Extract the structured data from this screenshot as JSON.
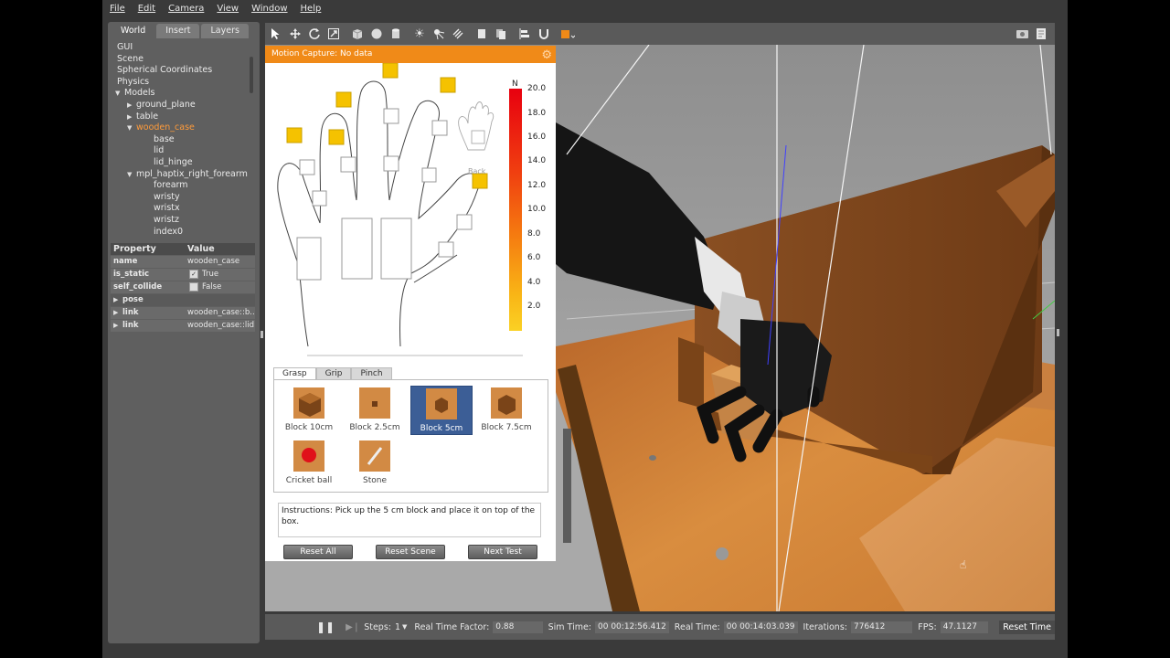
{
  "menu": [
    "File",
    "Edit",
    "Camera",
    "View",
    "Window",
    "Help"
  ],
  "left_tabs": [
    "World",
    "Insert",
    "Layers"
  ],
  "tree": [
    {
      "label": "GUI",
      "indent": 0,
      "arrow": ""
    },
    {
      "label": "Scene",
      "indent": 0,
      "arrow": ""
    },
    {
      "label": "Spherical Coordinates",
      "indent": 0,
      "arrow": ""
    },
    {
      "label": "Physics",
      "indent": 0,
      "arrow": ""
    },
    {
      "label": "Models",
      "indent": 0,
      "arrow": "down"
    },
    {
      "label": "ground_plane",
      "indent": 1,
      "arrow": "right"
    },
    {
      "label": "table",
      "indent": 1,
      "arrow": "right"
    },
    {
      "label": "wooden_case",
      "indent": 1,
      "arrow": "down",
      "selected": true
    },
    {
      "label": "base",
      "indent": 2,
      "arrow": ""
    },
    {
      "label": "lid",
      "indent": 2,
      "arrow": ""
    },
    {
      "label": "lid_hinge",
      "indent": 2,
      "arrow": ""
    },
    {
      "label": "mpl_haptix_right_forearm",
      "indent": 1,
      "arrow": "down"
    },
    {
      "label": "forearm",
      "indent": 2,
      "arrow": ""
    },
    {
      "label": "wristy",
      "indent": 2,
      "arrow": ""
    },
    {
      "label": "wristx",
      "indent": 2,
      "arrow": ""
    },
    {
      "label": "wristz",
      "indent": 2,
      "arrow": ""
    },
    {
      "label": "index0",
      "indent": 2,
      "arrow": ""
    }
  ],
  "props": {
    "header": [
      "Property",
      "Value"
    ],
    "name": {
      "label": "name",
      "value": "wooden_case"
    },
    "is_static": {
      "label": "is_static",
      "value": "True",
      "checked": true
    },
    "self_collide": {
      "label": "self_collide",
      "value": "False",
      "checked": false
    },
    "pose": "pose",
    "link1": {
      "label": "link",
      "value": "wooden_case::b..."
    },
    "link2": {
      "label": "link",
      "value": "wooden_case::lid"
    }
  },
  "mocap": {
    "title": "Motion Capture: No data",
    "back_label": "Back",
    "legend_unit": "N",
    "legend_ticks": [
      "20.0",
      "18.0",
      "16.0",
      "14.0",
      "12.0",
      "10.0",
      "8.0",
      "6.0",
      "4.0",
      "2.0"
    ],
    "tabs": [
      "Grasp",
      "Grip",
      "Pinch"
    ],
    "objects": [
      {
        "label": "Block 10cm"
      },
      {
        "label": "Block 2.5cm"
      },
      {
        "label": "Block 5cm",
        "selected": true
      },
      {
        "label": "Block 7.5cm"
      },
      {
        "label": "Cricket ball"
      },
      {
        "label": "Stone"
      }
    ],
    "instructions": "Instructions: Pick up the 5 cm block and place it on top of the box.",
    "buttons": [
      "Reset All",
      "Reset Scene",
      "Next Test"
    ]
  },
  "status": {
    "steps_label": "Steps:",
    "steps_value": "1",
    "rtf_label": "Real Time Factor:",
    "rtf_value": "0.88",
    "sim_label": "Sim Time:",
    "sim_value": "00 00:12:56.412",
    "real_label": "Real Time:",
    "real_value": "00 00:14:03.039",
    "iter_label": "Iterations:",
    "iter_value": "776412",
    "fps_label": "FPS:",
    "fps_value": "47.1127",
    "reset_label": "Reset Time"
  },
  "colors": {
    "accent": "#f08a18",
    "selected_item": "#3c5e96",
    "tree_selected": "#ff9b3a"
  }
}
